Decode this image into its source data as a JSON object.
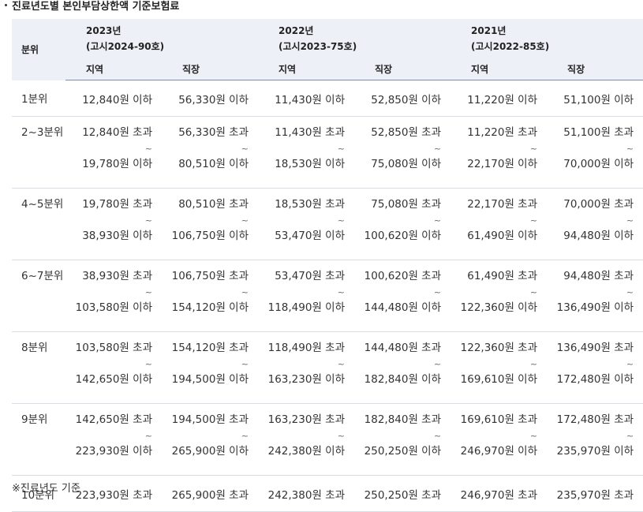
{
  "title": "진료년도별 본인부담상한액 기준보험료",
  "note": "※진료년도 기준",
  "header": {
    "quantile_label": "분위",
    "years": [
      {
        "year": "2023년",
        "notice": "(고시2024-90호)"
      },
      {
        "year": "2022년",
        "notice": "(고시2023-75호)"
      },
      {
        "year": "2021년",
        "notice": "(고시2022-85호)"
      }
    ],
    "sub": [
      "지역",
      "직장",
      "지역",
      "직장",
      "지역",
      "직장"
    ]
  },
  "tilde": "~",
  "rows": [
    {
      "label": "1분위",
      "type": "single",
      "cells": [
        "12,840원 이하",
        "56,330원 이하",
        "11,430원 이하",
        "52,850원 이하",
        "11,220원 이하",
        "51,100원 이하"
      ]
    },
    {
      "label": "2~3분위",
      "type": "range",
      "from": [
        "12,840원 초과",
        "56,330원 초과",
        "11,430원 초과",
        "52,850원 초과",
        "11,220원 초과",
        "51,100원 초과"
      ],
      "to": [
        "19,780원 이하",
        "80,510원 이하",
        "18,530원 이하",
        "75,080원 이하",
        "22,170원 이하",
        "70,000원 이하"
      ]
    },
    {
      "label": "4~5분위",
      "type": "range",
      "from": [
        "19,780원 초과",
        "80,510원 초과",
        "18,530원 초과",
        "75,080원 초과",
        "22,170원 초과",
        "70,000원 초과"
      ],
      "to": [
        "38,930원 이하",
        "106,750원 이하",
        "53,470원 이하",
        "100,620원 이하",
        "61,490원 이하",
        "94,480원 이하"
      ]
    },
    {
      "label": "6~7분위",
      "type": "range",
      "from": [
        "38,930원 초과",
        "106,750원 초과",
        "53,470원 초과",
        "100,620원 초과",
        "61,490원 초과",
        "94,480원 초과"
      ],
      "to": [
        "103,580원 이하",
        "154,120원 이하",
        "118,490원 이하",
        "144,480원 이하",
        "122,360원 이하",
        "136,490원 이하"
      ]
    },
    {
      "label": "8분위",
      "type": "range",
      "from": [
        "103,580원 초과",
        "154,120원 초과",
        "118,490원 초과",
        "144,480원 초과",
        "122,360원 초과",
        "136,490원 초과"
      ],
      "to": [
        "142,650원 이하",
        "194,500원 이하",
        "163,230원 이하",
        "182,840원 이하",
        "169,610원 이하",
        "172,480원 이하"
      ]
    },
    {
      "label": "9분위",
      "type": "range",
      "from": [
        "142,650원 초과",
        "194,500원 초과",
        "163,230원 초과",
        "182,840원 초과",
        "169,610원 초과",
        "172,480원 초과"
      ],
      "to": [
        "223,930원 이하",
        "265,900원 이하",
        "242,380원 이하",
        "250,250원 이하",
        "246,970원 이하",
        "235,970원 이하"
      ]
    },
    {
      "label": "10분위",
      "type": "single",
      "cells": [
        "223,930원 초과",
        "265,900원 초과",
        "242,380원 초과",
        "250,250원 초과",
        "246,970원 초과",
        "235,970원 초과"
      ]
    }
  ]
}
